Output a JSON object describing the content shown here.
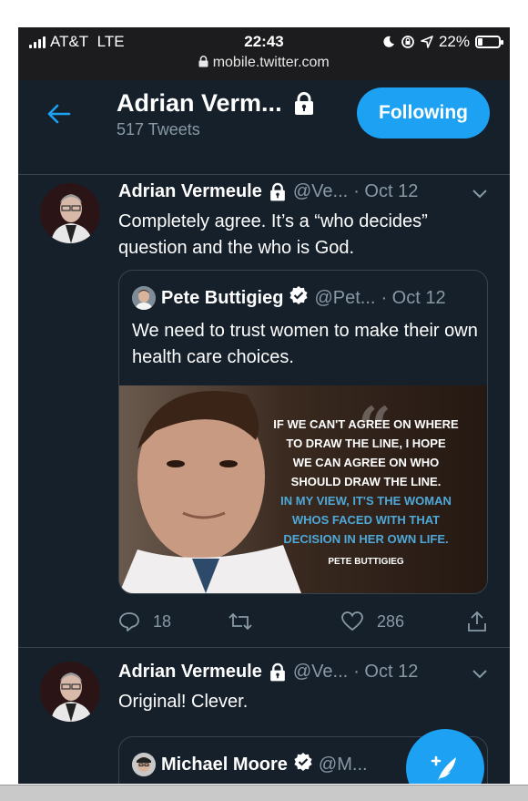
{
  "status_bar": {
    "carrier": "AT&T",
    "network": "LTE",
    "time": "22:43",
    "battery": "22%",
    "battery_level": 0.22,
    "url": "mobile.twitter.com"
  },
  "header": {
    "name": "Adrian Verm...",
    "tweet_count": "517 Tweets",
    "follow_label": "Following"
  },
  "tweets": [
    {
      "name": "Adrian Vermeule",
      "handle": "@Ve...",
      "date": "· Oct 12",
      "text": "Completely agree. It’s a “who decides” question and the who is God.",
      "quote": {
        "name": "Pete Buttigieg",
        "handle": "@Pet...",
        "date": "· Oct 12",
        "text": "We need to trust women to make their own health care choices.",
        "image_lines_white": [
          "IF WE CAN'T AGREE ON WHERE",
          "TO DRAW THE LINE, I HOPE",
          "WE CAN AGREE ON WHO",
          "SHOULD DRAW THE LINE."
        ],
        "image_lines_blue": [
          "IN MY VIEW, IT'S THE WOMAN",
          "WHOS FACED WITH THAT",
          "DECISION IN HER OWN LIFE."
        ],
        "image_attribution": "PETE BUTTIGIEG"
      },
      "replies": "18",
      "likes": "286"
    },
    {
      "name": "Adrian Vermeule",
      "handle": "@Ve...",
      "date": "· Oct 12",
      "text": "Original! Clever.",
      "quote": {
        "name": "Michael Moore",
        "handle": "@M..."
      }
    }
  ],
  "colors": {
    "background": "#15202b",
    "accent": "#1da1f2",
    "muted": "#8899a6",
    "border": "#38444d"
  }
}
